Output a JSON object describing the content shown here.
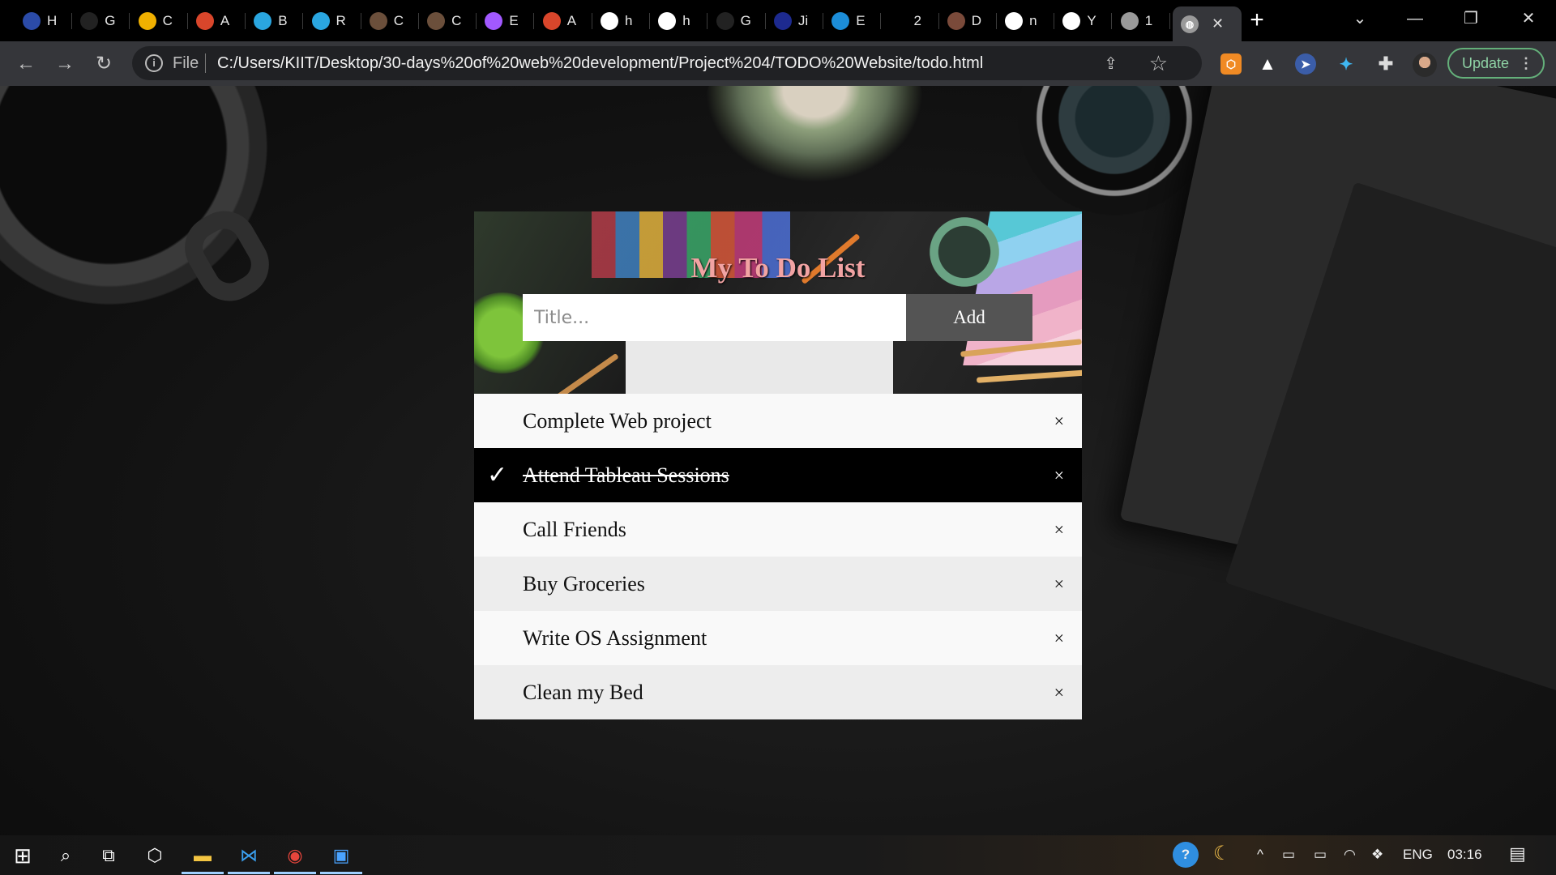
{
  "browser": {
    "tabs": [
      {
        "label": "H",
        "icon": "app-icon",
        "color": "#2b4ba8"
      },
      {
        "label": "G",
        "icon": "deepl-icon",
        "color": "#222222"
      },
      {
        "label": "C",
        "icon": "figure-icon",
        "color": "#f0b000"
      },
      {
        "label": "A",
        "icon": "arc-icon",
        "color": "#d9462b"
      },
      {
        "label": "B",
        "icon": "canva-icon",
        "color": "#2aa6e0"
      },
      {
        "label": "R",
        "icon": "canva-icon",
        "color": "#2aa6e0"
      },
      {
        "label": "C",
        "icon": "cc-icon",
        "color": "#6b4f3b"
      },
      {
        "label": "C",
        "icon": "cc-icon",
        "color": "#6b4f3b"
      },
      {
        "label": "E",
        "icon": "figma-icon",
        "color": "#a259ff"
      },
      {
        "label": "A",
        "icon": "arc-icon",
        "color": "#d9462b"
      },
      {
        "label": "h",
        "icon": "github-icon",
        "color": "#ffffff"
      },
      {
        "label": "h",
        "icon": "google-icon",
        "color": "#ffffff"
      },
      {
        "label": "G",
        "icon": "deepl-icon",
        "color": "#222222"
      },
      {
        "label": "Ji",
        "icon": "jio-icon",
        "color": "#1d2a8f"
      },
      {
        "label": "E",
        "icon": "edx-icon",
        "color": "#1c8dd8"
      },
      {
        "label": "2",
        "icon": "circle-icon",
        "color": "#000000"
      },
      {
        "label": "D",
        "icon": "person-icon",
        "color": "#7a4a3a"
      },
      {
        "label": "n",
        "icon": "google-icon",
        "color": "#ffffff"
      },
      {
        "label": "Y",
        "icon": "github-icon",
        "color": "#ffffff"
      },
      {
        "label": "1",
        "icon": "globe-icon",
        "color": "#9a9a9a"
      }
    ],
    "active_tab_close": "✕",
    "new_tab": "+",
    "scheme": "File",
    "url": "C:/Users/KIIT/Desktop/30-days%20of%20web%20development/Project%204/TODO%20Website/todo.html",
    "update_label": "Update"
  },
  "app": {
    "title": "My To Do List",
    "input_placeholder": "Title...",
    "add_label": "Add",
    "close_symbol": "×",
    "check_symbol": "✓",
    "items": [
      {
        "text": "Complete Web project",
        "checked": false
      },
      {
        "text": "Attend Tableau Sessions",
        "checked": true
      },
      {
        "text": "Call Friends",
        "checked": false
      },
      {
        "text": "Buy Groceries",
        "checked": false
      },
      {
        "text": "Write OS Assignment",
        "checked": false
      },
      {
        "text": "Clean my Bed",
        "checked": false
      }
    ]
  },
  "taskbar": {
    "language": "ENG",
    "time": "03:16"
  }
}
